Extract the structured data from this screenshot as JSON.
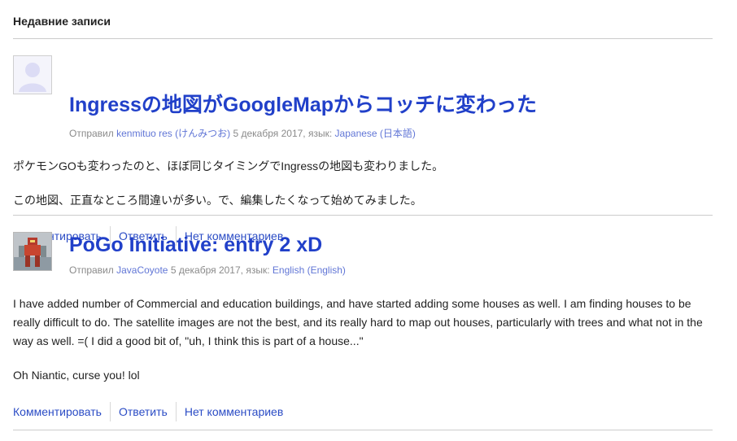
{
  "section_title": "Недавние записи",
  "posts": [
    {
      "title": "Ingressの地図がGoogleMapからコッチに変わった",
      "meta": {
        "sent_by": "Отправил",
        "author": "kenmituo res (けんみつお)",
        "date": "5 декабря 2017,",
        "lang_label": "язык:",
        "language": "Japanese (日本語)"
      },
      "paragraphs": [
        "ポケモンGOも変わったのと、ほぼ同じタイミングでIngressの地図も変わりました。",
        "この地図、正直なところ間違いが多い。で、編集したくなって始めてみました。"
      ]
    },
    {
      "title": "PoGo Initiative: entry 2 xD",
      "meta": {
        "sent_by": "Отправил",
        "author": "JavaCoyote",
        "date": "5 декабря 2017,",
        "lang_label": "язык:",
        "language": "English (English)"
      },
      "paragraphs": [
        "I have added number of Commercial and education buildings, and have started adding some houses as well. I am finding houses to be really difficult to do. The satellite images are not the best, and its really hard to map out houses, particularly with trees and what not in the way as well. =( I did a good bit of, \"uh, I think this is part of a house...\"",
        "Oh Niantic, curse you! lol"
      ]
    }
  ],
  "actions": {
    "comment": "Комментировать",
    "reply": "Ответить",
    "no_comments": "Нет комментариев"
  }
}
